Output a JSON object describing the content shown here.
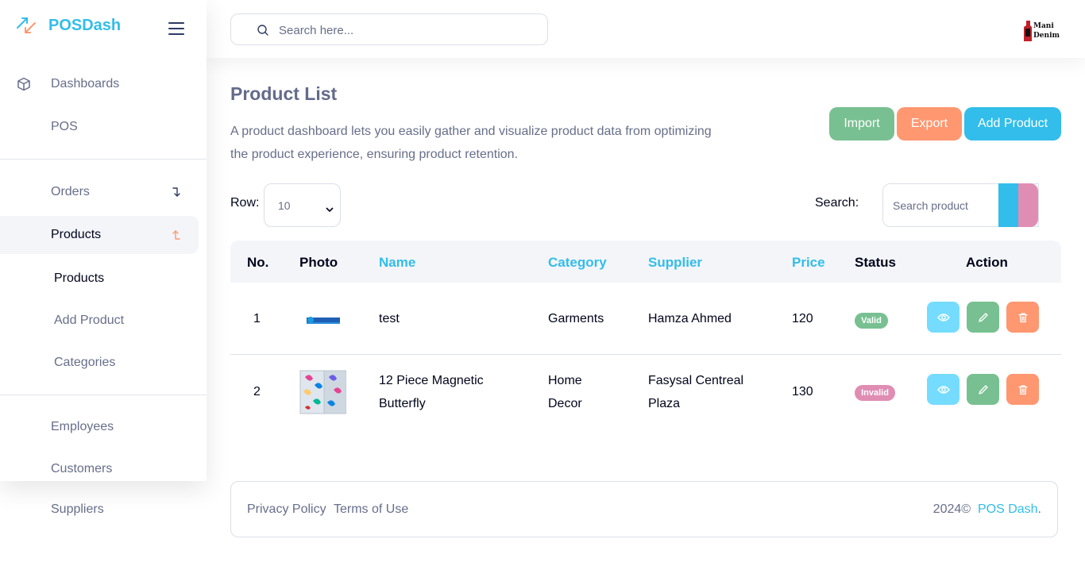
{
  "app": {
    "name": "POSDash"
  },
  "topbar": {
    "search_placeholder": "Search here...",
    "user_logo_line1": "Mani",
    "user_logo_line2": "Denim"
  },
  "sidebar": {
    "items": [
      {
        "label": "Dashboards",
        "icon": "cube-icon"
      },
      {
        "label": "POS"
      },
      {
        "label": "Orders",
        "icon": "arrow-down-right-icon"
      },
      {
        "label": "Products",
        "icon": "arrow-up-left-icon"
      },
      {
        "label": "Employees"
      },
      {
        "label": "Customers"
      },
      {
        "label": "Suppliers"
      }
    ],
    "products_sub": [
      {
        "label": "Products"
      },
      {
        "label": "Add Product"
      },
      {
        "label": "Categories"
      }
    ]
  },
  "page": {
    "title": "Product List",
    "description": "A product dashboard lets you easily gather and visualize product data from optimizing the product experience, ensuring product retention.",
    "buttons": {
      "import": "Import",
      "export": "Export",
      "add": "Add Product"
    },
    "row_label": "Row:",
    "row_value": "10",
    "search_label": "Search:",
    "search_placeholder": "Search product"
  },
  "table": {
    "headers": [
      "No.",
      "Photo",
      "Name",
      "Category",
      "Supplier",
      "Price",
      "Status",
      "Action"
    ],
    "rows": [
      {
        "no": "1",
        "name_line1": "test",
        "name_line2": "",
        "category_line1": "Garments",
        "category_line2": "",
        "supplier_line1": "Hamza Ahmed",
        "supplier_line2": "",
        "price": "120",
        "status": "Valid"
      },
      {
        "no": "2",
        "name_line1": "12 Piece Magnetic",
        "name_line2": "Butterfly",
        "category_line1": "Home",
        "category_line2": "Decor",
        "supplier_line1": "Fasysal Centreal",
        "supplier_line2": "Plaza",
        "price": "130",
        "status": "Invalid"
      }
    ]
  },
  "footer": {
    "privacy": "Privacy Policy",
    "terms": "Terms of Use",
    "copyright": "2024©",
    "brand": "POS Dash",
    "period": "."
  },
  "colors": {
    "accent": "#32bdea",
    "green": "#78c091",
    "orange": "#ff9770",
    "pink": "#e08db4",
    "light_blue": "#75dcff"
  }
}
